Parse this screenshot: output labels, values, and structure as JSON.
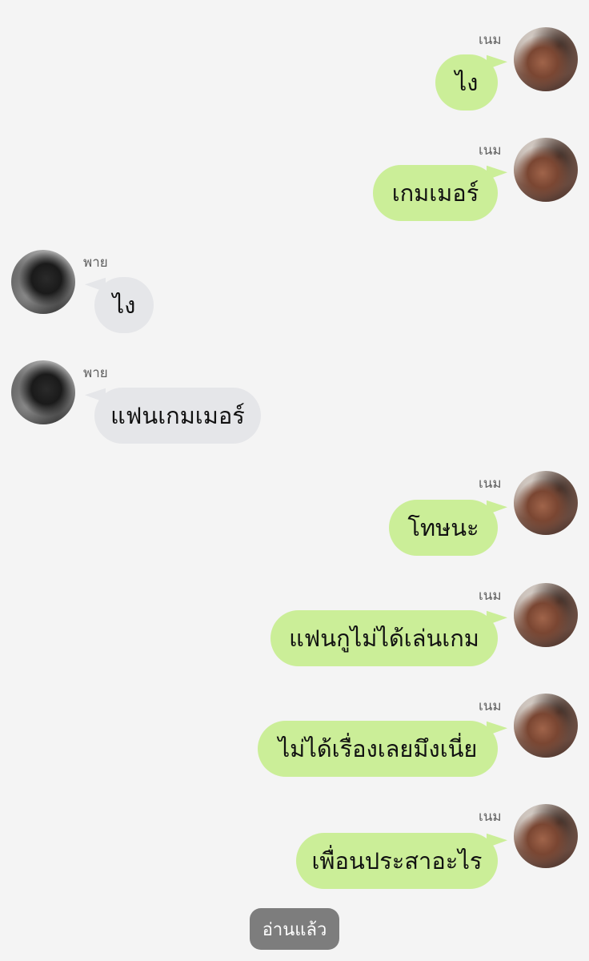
{
  "contacts": {
    "me": "เนม",
    "them": "พาย"
  },
  "messages": [
    {
      "side": "me",
      "sender": "เนม",
      "text": "ไง"
    },
    {
      "side": "me",
      "sender": "เนม",
      "text": "เกมเมอร์"
    },
    {
      "side": "them",
      "sender": "พาย",
      "text": "ไง"
    },
    {
      "side": "them",
      "sender": "พาย",
      "text": "แฟนเกมเมอร์"
    },
    {
      "side": "me",
      "sender": "เนม",
      "text": "โทษนะ"
    },
    {
      "side": "me",
      "sender": "เนม",
      "text": "แฟนกูไม่ได้เล่นเกม"
    },
    {
      "side": "me",
      "sender": "เนม",
      "text": "ไม่ได้เรื่องเลยมึงเนี่ย"
    },
    {
      "side": "me",
      "sender": "เนม",
      "text": "เพื่อนประสาอะไร"
    }
  ],
  "read_status": "อ่านแล้ว",
  "colors": {
    "background": "#f4f4f4",
    "my_bubble": "#cbee98",
    "their_bubble": "#e5e6e9",
    "read_badge": "#7d7d7d"
  }
}
